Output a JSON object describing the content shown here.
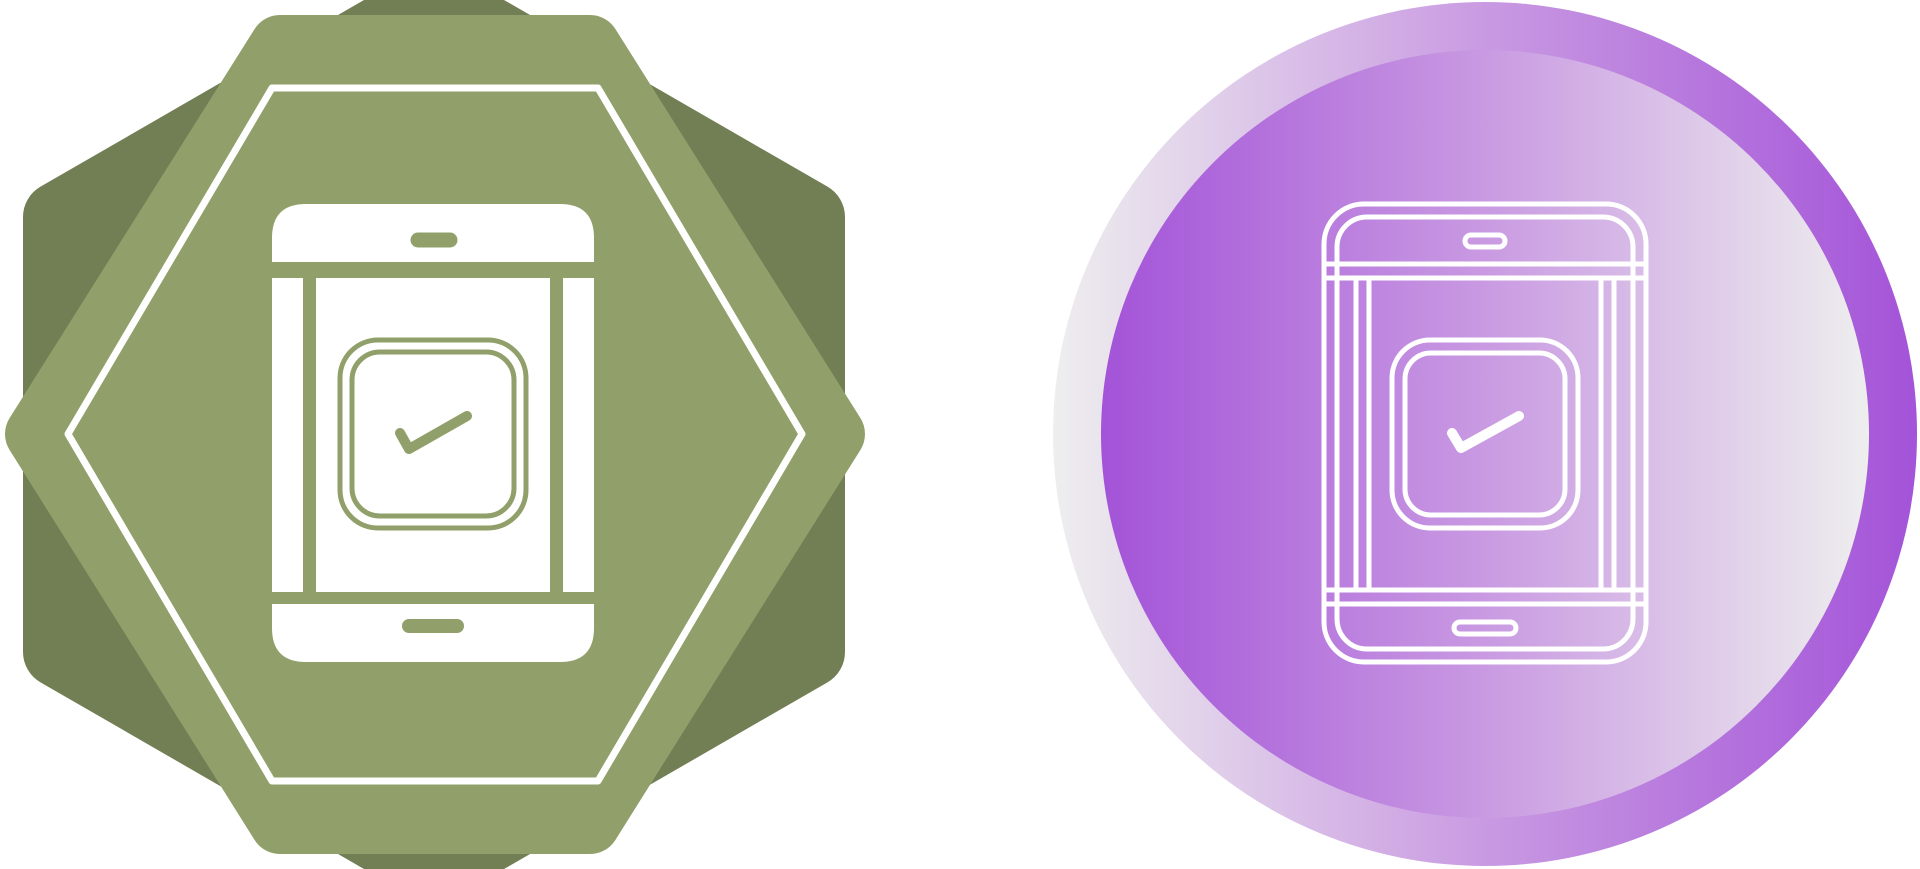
{
  "icons": [
    {
      "name": "mobile-checklist-glyph-icon",
      "style": "glyph",
      "badge_shape": "hexagon-star-badge",
      "colors": {
        "badge_dark": "#727f55",
        "badge_light": "#91a06a",
        "foreground": "#ffffff"
      }
    },
    {
      "name": "mobile-checklist-line-icon",
      "style": "line",
      "badge_shape": "circle-gradient",
      "colors": {
        "gradient_start": "#a353d8",
        "gradient_mid": "#c99ae2",
        "gradient_end": "#eeeeee",
        "foreground": "#ffffff"
      }
    }
  ]
}
